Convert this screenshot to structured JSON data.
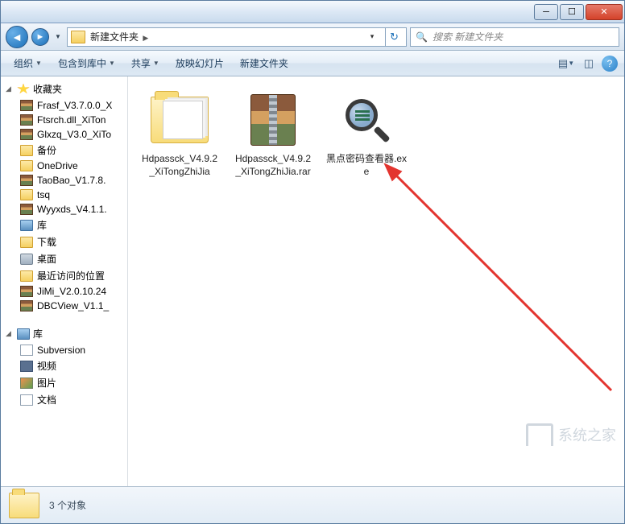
{
  "titlebar": {},
  "nav": {
    "path_parts": [
      "新建文件夹"
    ],
    "search_placeholder": "搜索 新建文件夹"
  },
  "toolbar": {
    "organize": "组织",
    "include": "包含到库中",
    "share": "共享",
    "slideshow": "放映幻灯片",
    "new_folder": "新建文件夹"
  },
  "sidebar": {
    "favorites": {
      "label": "收藏夹",
      "items": [
        {
          "icon": "rar",
          "label": "Frasf_V3.7.0.0_X"
        },
        {
          "icon": "rar",
          "label": "Ftsrch.dll_XiTon"
        },
        {
          "icon": "rar",
          "label": "Glxzq_V3.0_XiTo"
        },
        {
          "icon": "folder",
          "label": "备份"
        },
        {
          "icon": "folder",
          "label": "OneDrive"
        },
        {
          "icon": "rar",
          "label": "TaoBao_V1.7.8."
        },
        {
          "icon": "folder",
          "label": "tsq"
        },
        {
          "icon": "rar",
          "label": "Wyyxds_V4.1.1."
        },
        {
          "icon": "lib",
          "label": "库"
        },
        {
          "icon": "folder",
          "label": "下载"
        },
        {
          "icon": "disk",
          "label": "桌面"
        },
        {
          "icon": "folder",
          "label": "最近访问的位置"
        },
        {
          "icon": "rar",
          "label": "JiMi_V2.0.10.24"
        },
        {
          "icon": "rar",
          "label": "DBCView_V1.1_"
        }
      ]
    },
    "libraries": {
      "label": "库",
      "items": [
        {
          "icon": "doc",
          "label": "Subversion"
        },
        {
          "icon": "vid",
          "label": "视频"
        },
        {
          "icon": "pic",
          "label": "图片"
        },
        {
          "icon": "doc",
          "label": "文档"
        }
      ]
    }
  },
  "files": [
    {
      "type": "folder",
      "label": "Hdpassck_V4.9.2_XiTongZhiJia"
    },
    {
      "type": "rar",
      "label": "Hdpassck_V4.9.2_XiTongZhiJia.rar"
    },
    {
      "type": "exe",
      "label": "黑点密码查看器.exe"
    }
  ],
  "status": {
    "count_text": "3 个对象"
  },
  "watermark": {
    "text": "系统之家"
  }
}
